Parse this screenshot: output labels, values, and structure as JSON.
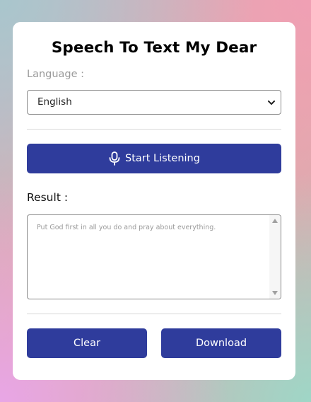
{
  "app": {
    "title": "Speech To Text My Dear"
  },
  "language": {
    "label": "Language :",
    "selected": "English"
  },
  "listen": {
    "label": "Start Listening",
    "icon": "microphone-icon"
  },
  "result": {
    "label": "Result :",
    "placeholder": "Put God first in all you do and pray about everything."
  },
  "actions": {
    "clear_label": "Clear",
    "download_label": "Download"
  },
  "colors": {
    "accent": "#2f3c9c",
    "card": "#ffffff"
  }
}
